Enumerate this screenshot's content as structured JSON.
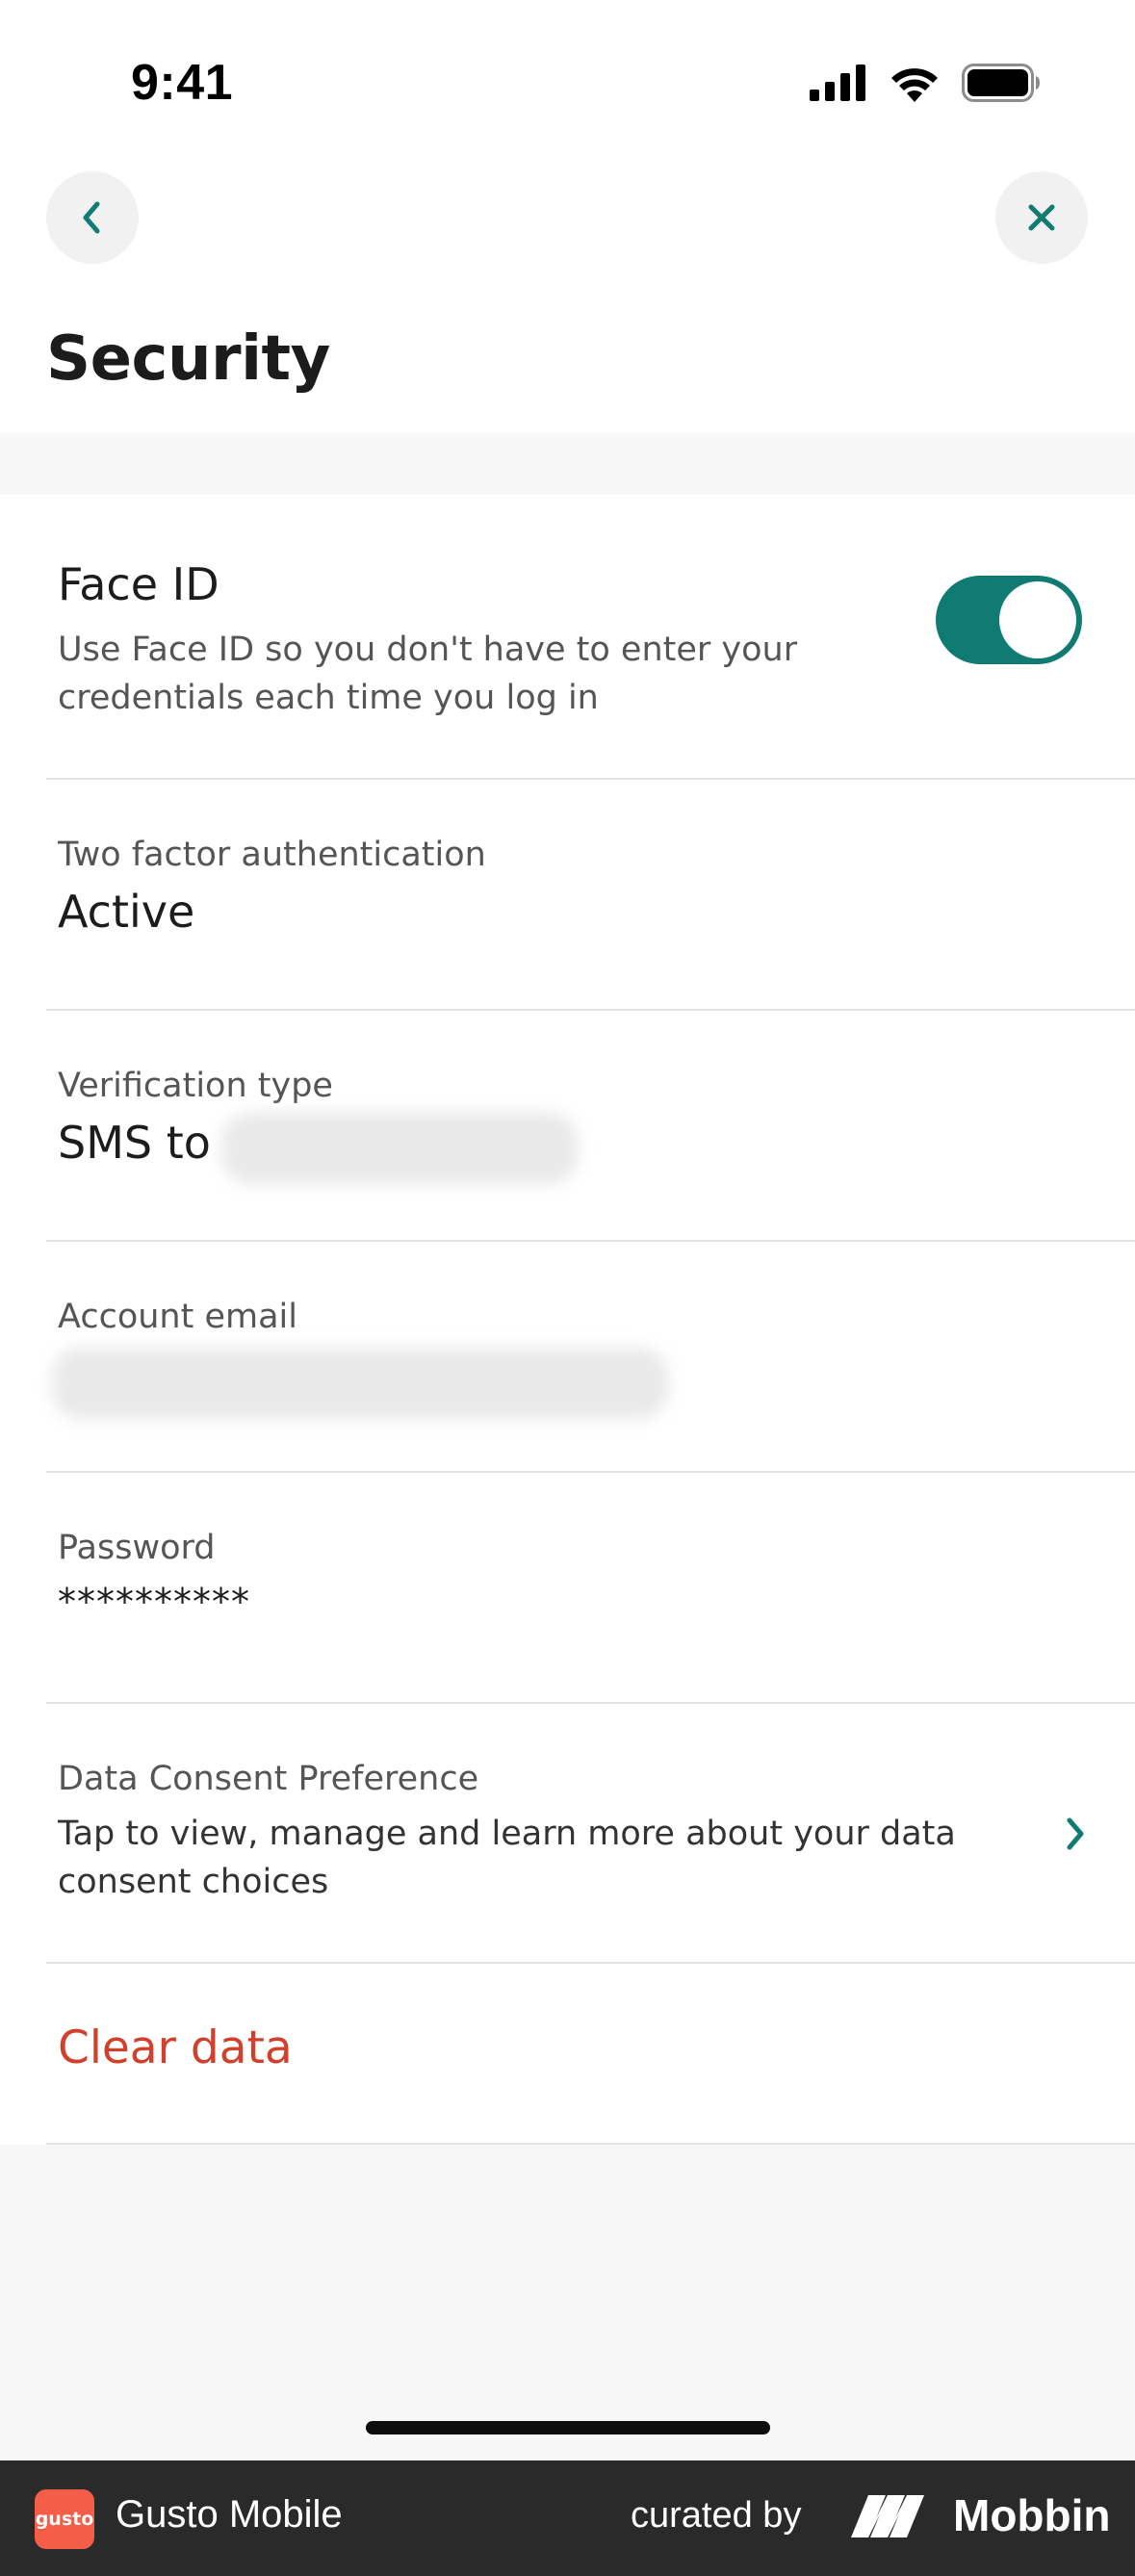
{
  "status_bar": {
    "time": "9:41"
  },
  "header": {
    "title": "Security"
  },
  "settings": {
    "face_id": {
      "title": "Face ID",
      "description_line1": "Use Face ID so you don't have to enter your",
      "description_line2": "credentials each time you log in",
      "enabled": true
    },
    "two_factor": {
      "label": "Two factor authentication",
      "value": "Active"
    },
    "verification": {
      "label": "Verification type",
      "value_prefix": "SMS to"
    },
    "account_email": {
      "label": "Account email"
    },
    "password": {
      "label": "Password",
      "value": "**********"
    },
    "data_consent": {
      "label": "Data Consent Preference",
      "description_line1": "Tap to view, manage and learn more about your data",
      "description_line2": "consent choices"
    },
    "clear_data": {
      "label": "Clear data"
    }
  },
  "footer": {
    "app_logo_text": "gusto",
    "app_name": "Gusto Mobile",
    "curated_by": "curated by",
    "brand": "Mobbin"
  },
  "colors": {
    "accent": "#0f7b73",
    "danger": "#d2402b",
    "footer_bg": "#2a2a2a",
    "gusto_brand": "#f45d48"
  },
  "icons": [
    "cellular-signal-icon",
    "wifi-icon",
    "battery-icon",
    "back-chevron-icon",
    "close-icon",
    "chevron-right-icon",
    "mobbin-logo-icon"
  ]
}
